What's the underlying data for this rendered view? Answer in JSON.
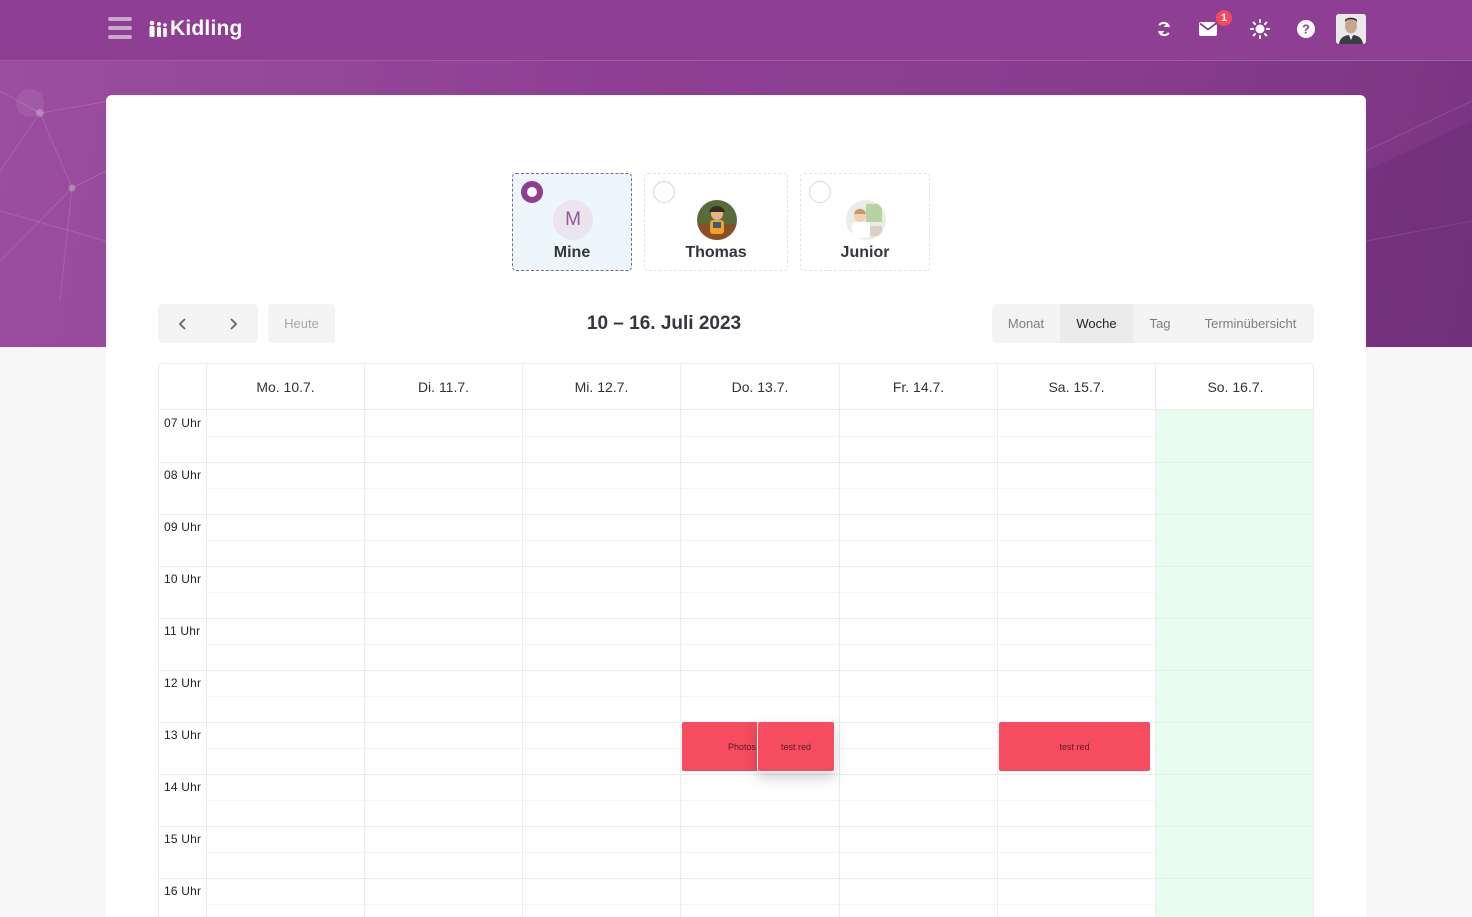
{
  "header": {
    "logo_text": "Kidling",
    "notification_count": "1",
    "icons": [
      "menu-icon",
      "refresh-icon",
      "mail-icon",
      "sun-icon",
      "help-icon"
    ]
  },
  "children": [
    {
      "name": "Mine",
      "initial": "M",
      "selected": true
    },
    {
      "name": "Thomas",
      "initial": "",
      "selected": false
    },
    {
      "name": "Junior",
      "initial": "",
      "selected": false
    }
  ],
  "toolbar": {
    "today_label": "Heute",
    "range_title": "10 – 16. Juli 2023",
    "views": [
      "Monat",
      "Woche",
      "Tag",
      "Terminübersicht"
    ],
    "active_view": "Woche"
  },
  "calendar": {
    "days": [
      "Mo. 10.7.",
      "Di. 11.7.",
      "Mi. 12.7.",
      "Do. 13.7.",
      "Fr. 14.7.",
      "Sa. 15.7.",
      "So. 16.7."
    ],
    "hours": [
      "07 Uhr",
      "08 Uhr",
      "09 Uhr",
      "10 Uhr",
      "11 Uhr",
      "12 Uhr",
      "13 Uhr",
      "14 Uhr",
      "15 Uhr",
      "16 Uhr"
    ],
    "events": [
      {
        "title": "Photos",
        "day": "Do. 13.7.",
        "start": "13 Uhr",
        "end": "14 Uhr"
      },
      {
        "title": "test red",
        "day": "Do. 13.7.",
        "start": "13 Uhr",
        "end": "14 Uhr"
      },
      {
        "title": "test red",
        "day": "Sa. 15.7.",
        "start": "13 Uhr",
        "end": "14 Uhr"
      }
    ],
    "highlight_day": "So. 16.7.",
    "colors": {
      "event": "#f64c5f",
      "highlight": "#e8fdf0",
      "brand": "#8e3f93"
    }
  }
}
